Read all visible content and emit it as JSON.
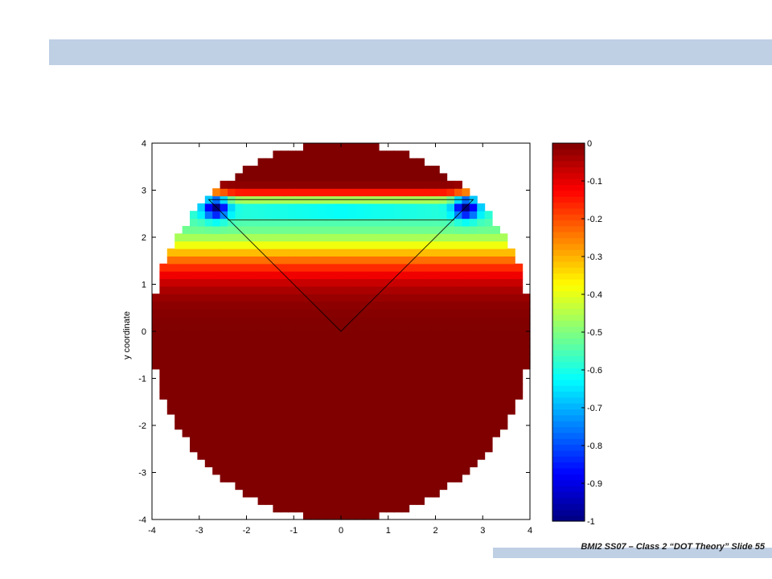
{
  "footer": {
    "text": "BMI2 SS07 – Class 2 “DOT Theory” Slide 55"
  },
  "chart_data": {
    "type": "heatmap",
    "title": "",
    "xlabel": "",
    "ylabel": "y coordinate",
    "xlim": [
      -4,
      4
    ],
    "ylim": [
      -4,
      4
    ],
    "x_ticks": [
      "-4",
      "-3",
      "-2",
      "-1",
      "0",
      "1",
      "2",
      "3",
      "4"
    ],
    "y_ticks": [
      "-4",
      "-3",
      "-2",
      "-1",
      "0",
      "1",
      "2",
      "3",
      "4"
    ],
    "domain": {
      "shape": "disk",
      "center": [
        0,
        0
      ],
      "radius": 4
    },
    "overlay_triangle": {
      "vertices": [
        [
          -2.8,
          2.8
        ],
        [
          2.8,
          2.8
        ],
        [
          0,
          0
        ]
      ],
      "inner_chord": [
        [
          -2.4,
          2.37
        ],
        [
          2.4,
          2.37
        ]
      ]
    },
    "colorbar": {
      "colormap": "jet",
      "clim": [
        -1,
        0
      ],
      "ticks": [
        "0",
        "-0.1",
        "-0.2",
        "-0.3",
        "-0.4",
        "-0.5",
        "-0.6",
        "-0.7",
        "-0.8",
        "-0.9",
        "-1"
      ]
    },
    "field_description_values": {
      "background_value": 0,
      "band_min_y": 2.4,
      "band_max_y": 2.8,
      "corner_minimum": -1
    },
    "grid": false
  }
}
